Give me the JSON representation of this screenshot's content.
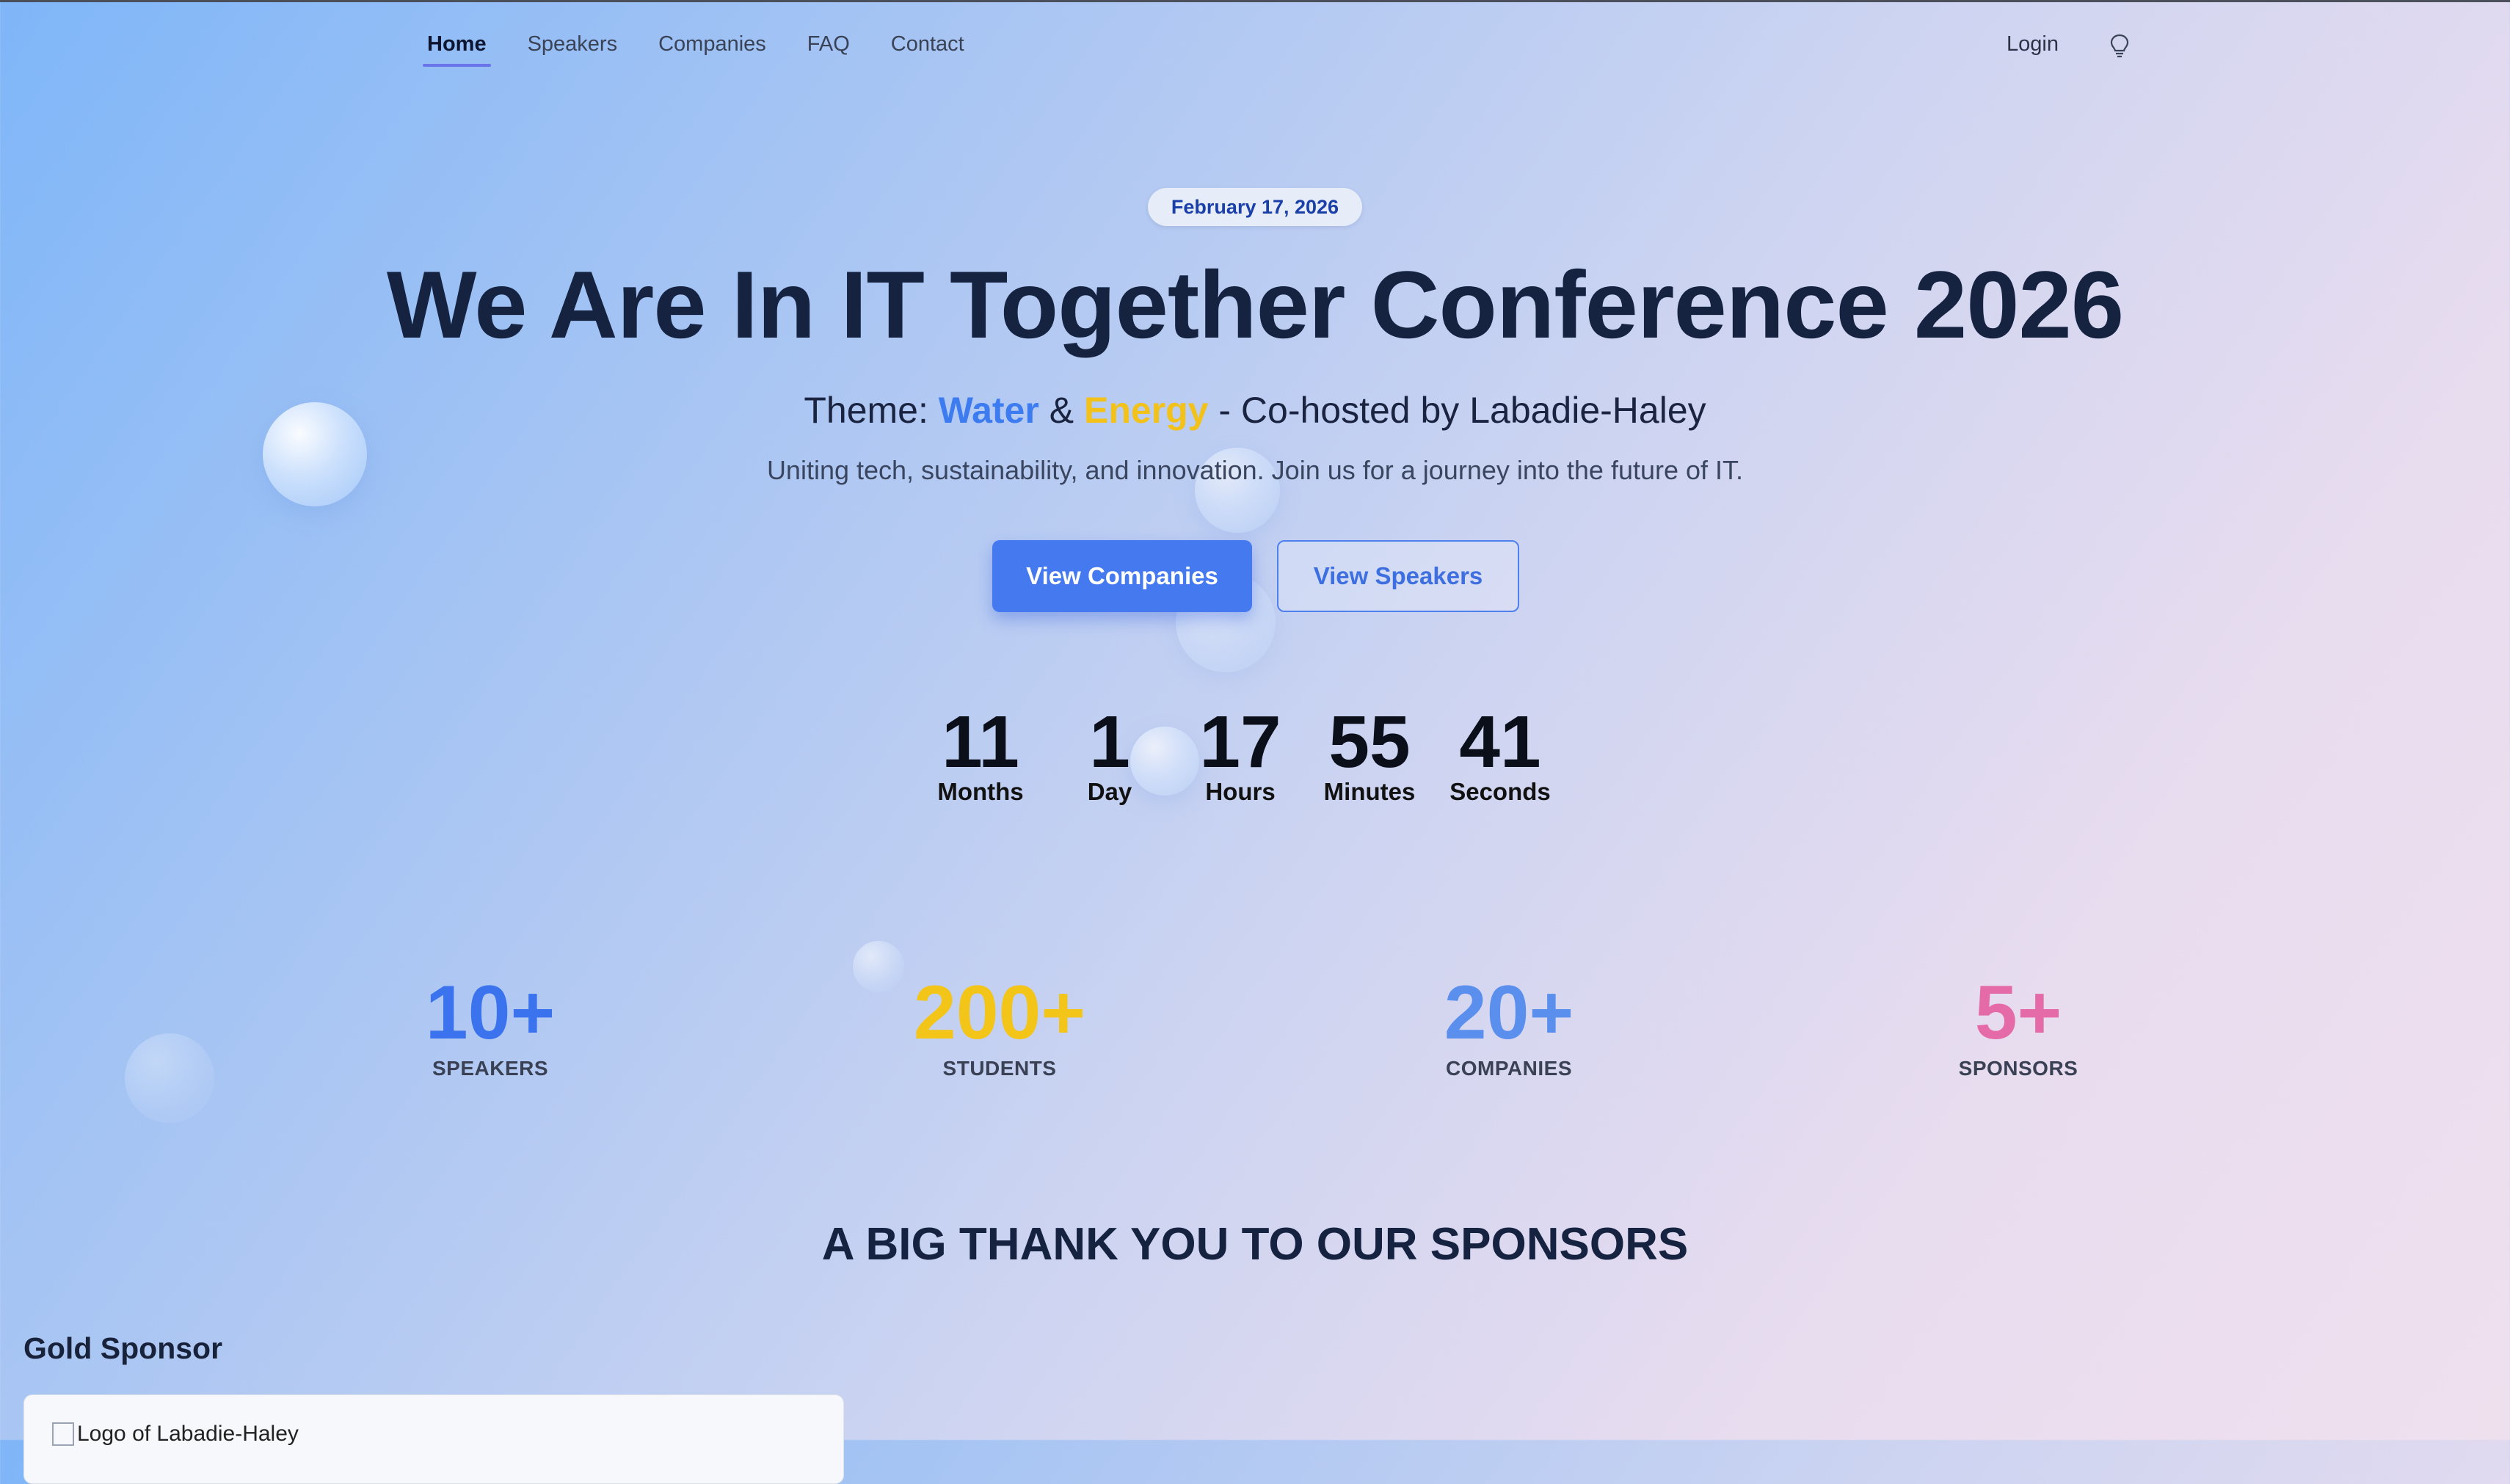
{
  "nav": {
    "items": [
      {
        "label": "Home",
        "active": true
      },
      {
        "label": "Speakers",
        "active": false
      },
      {
        "label": "Companies",
        "active": false
      },
      {
        "label": "FAQ",
        "active": false
      },
      {
        "label": "Contact",
        "active": false
      }
    ],
    "login_label": "Login",
    "theme_toggle_icon": "lightbulb-icon"
  },
  "hero": {
    "date": "February 17, 2026",
    "title": "We Are In IT Together Conference 2026",
    "theme_prefix": "Theme: ",
    "theme_water": "Water",
    "theme_amp": " & ",
    "theme_energy": "Energy",
    "theme_suffix": " - Co-hosted by Labadie-Haley",
    "tagline": "Uniting tech, sustainability, and innovation. Join us for a journey into the future of IT.",
    "primary_button": "View Companies",
    "secondary_button": "View Speakers"
  },
  "countdown": [
    {
      "value": "11",
      "label": "Months"
    },
    {
      "value": "1",
      "label": "Day"
    },
    {
      "value": "17",
      "label": "Hours"
    },
    {
      "value": "55",
      "label": "Minutes"
    },
    {
      "value": "41",
      "label": "Seconds"
    }
  ],
  "stats": [
    {
      "value": "10+",
      "label": "SPEAKERS",
      "color": "#3b73ee"
    },
    {
      "value": "200+",
      "label": "STUDENTS",
      "color": "#f3c519"
    },
    {
      "value": "20+",
      "label": "COMPANIES",
      "color": "#5b8fee"
    },
    {
      "value": "5+",
      "label": "SPONSORS",
      "color": "#e56aa8"
    }
  ],
  "sponsors": {
    "heading": "A BIG THANK YOU TO OUR SPONSORS",
    "tier": "Gold Sponsor",
    "logo_alt": "Logo of Labadie-Haley"
  },
  "colors": {
    "accent": "#4479f0",
    "water": "#3d7bf0",
    "energy": "#f2c21a",
    "nav_underline": "#6b74e8"
  }
}
